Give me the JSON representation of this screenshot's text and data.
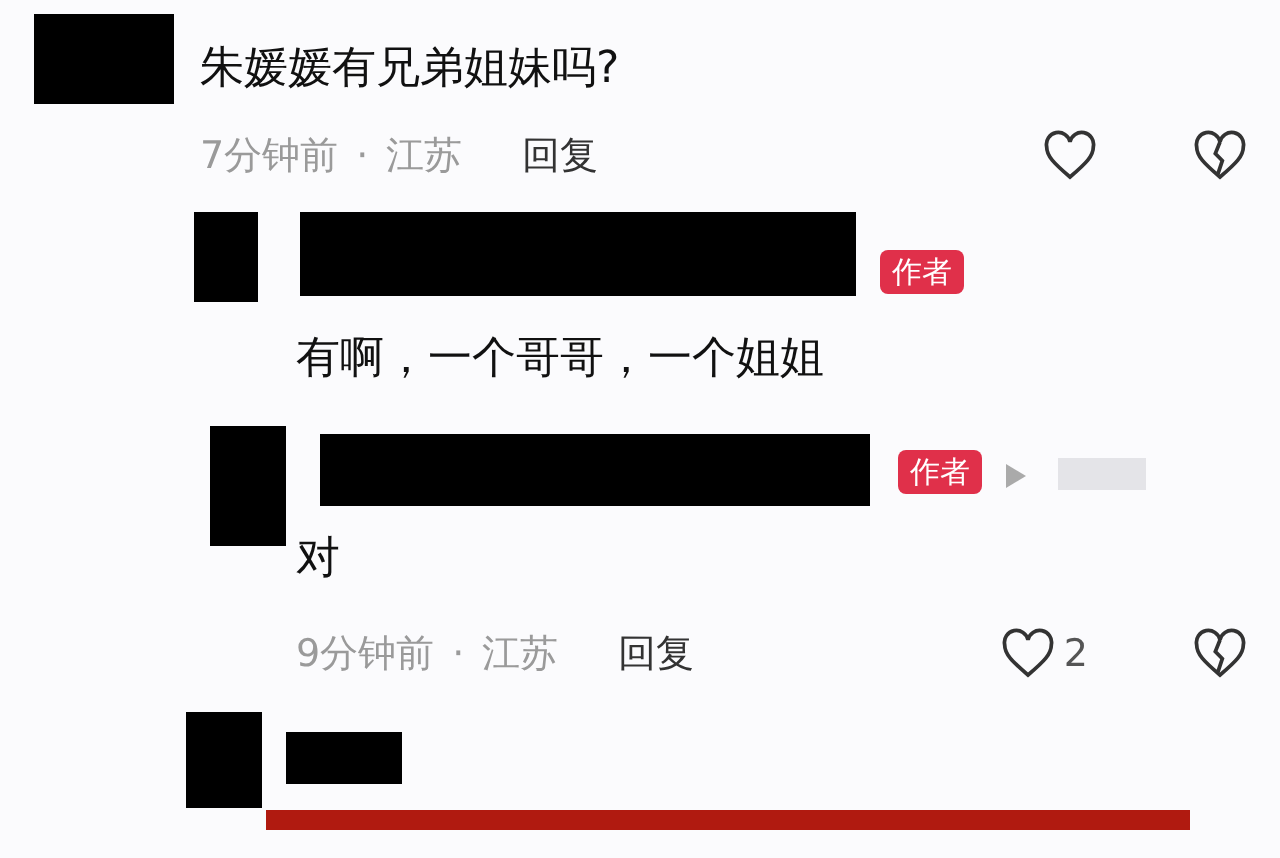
{
  "comment": {
    "text": "朱媛媛有兄弟姐妹吗?",
    "time": "7分钟前",
    "separator": "·",
    "region": "江苏",
    "reply_label": "回复"
  },
  "replies": [
    {
      "author_tag": "作者",
      "has_reply_target": false,
      "text": "有啊，一个哥哥，一个姐姐"
    },
    {
      "author_tag": "作者",
      "has_reply_target": true,
      "text": "对",
      "time": "9分钟前",
      "separator": "·",
      "region": "江苏",
      "reply_label": "回复",
      "like_count": "2"
    }
  ]
}
